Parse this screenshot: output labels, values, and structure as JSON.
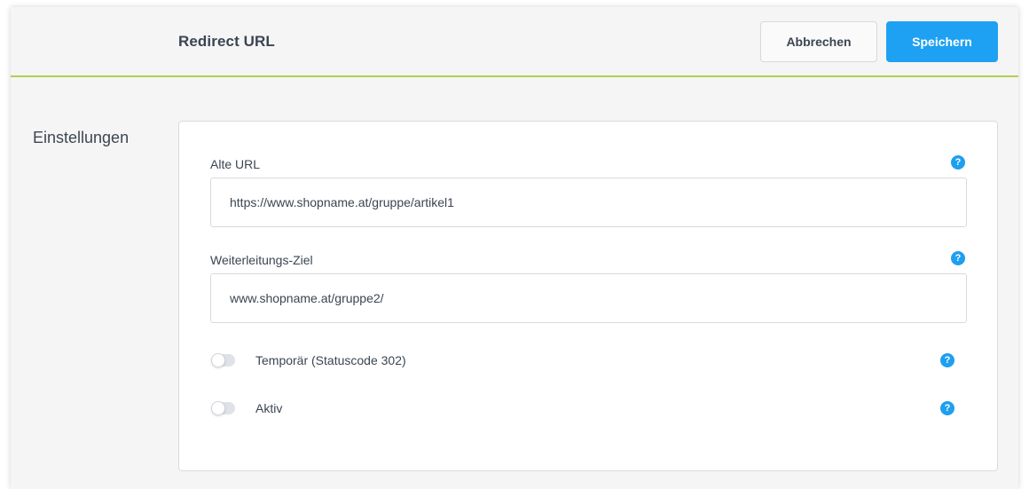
{
  "header": {
    "title": "Redirect URL",
    "cancel_label": "Abbrechen",
    "save_label": "Speichern"
  },
  "section": {
    "label": "Einstellungen"
  },
  "form": {
    "old_url": {
      "label": "Alte URL",
      "value": "https://www.shopname.at/gruppe/artikel1",
      "help_icon": "question-circle-icon"
    },
    "target": {
      "label": "Weiterleitungs-Ziel",
      "value": "www.shopname.at/gruppe2/",
      "help_icon": "question-circle-icon"
    },
    "temporary": {
      "label": "Temporär (Statuscode 302)",
      "checked": false,
      "help_icon": "question-circle-icon"
    },
    "active": {
      "label": "Aktiv",
      "checked": false,
      "help_icon": "question-circle-icon"
    }
  },
  "colors": {
    "accent": "#1ea1f2",
    "header_border": "#b3cf53",
    "background": "#f5f5f5"
  }
}
